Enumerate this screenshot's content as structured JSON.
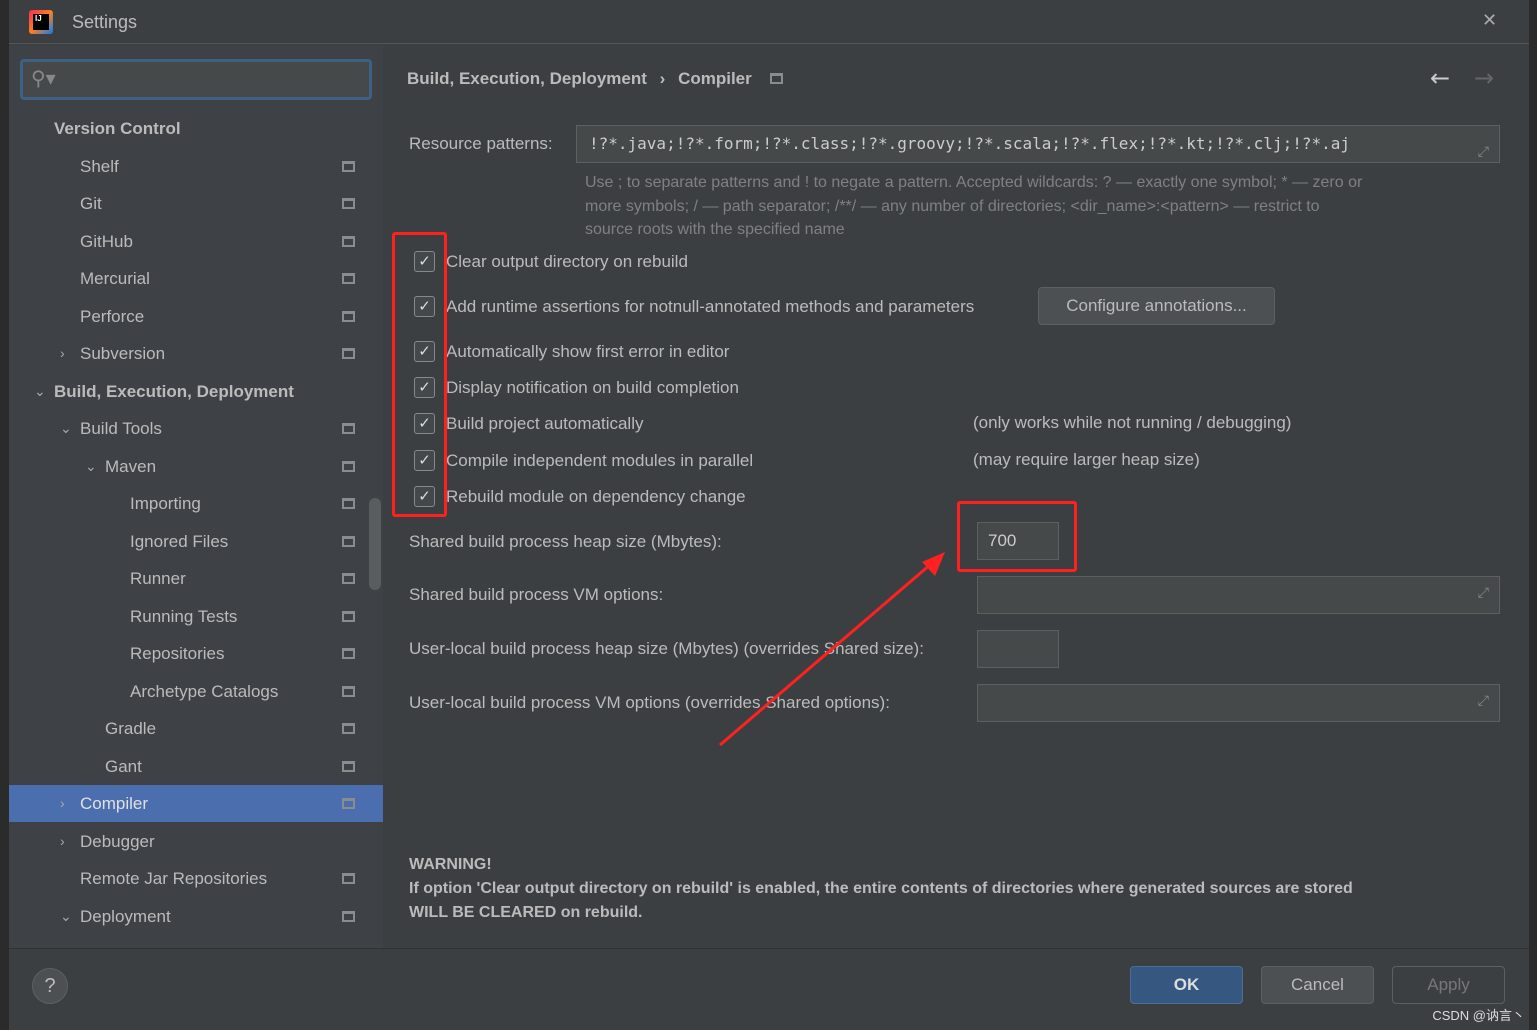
{
  "window": {
    "title": "Settings",
    "close": "✕"
  },
  "search": {
    "placeholder": ""
  },
  "tree": [
    {
      "label": "Version Control",
      "bold": true,
      "indent": 0,
      "chev": "",
      "proj": false
    },
    {
      "label": "Shelf",
      "indent": 1,
      "proj": true
    },
    {
      "label": "Git",
      "indent": 1,
      "proj": true
    },
    {
      "label": "GitHub",
      "indent": 1,
      "proj": true
    },
    {
      "label": "Mercurial",
      "indent": 1,
      "proj": true
    },
    {
      "label": "Perforce",
      "indent": 1,
      "proj": true
    },
    {
      "label": "Subversion",
      "indent": 1,
      "chev": "›",
      "proj": true
    },
    {
      "label": "Build, Execution, Deployment",
      "bold": true,
      "indent": 0,
      "chev": "⌄",
      "proj": false
    },
    {
      "label": "Build Tools",
      "indent": 1,
      "chev": "⌄",
      "proj": true
    },
    {
      "label": "Maven",
      "indent": 2,
      "chev": "⌄",
      "proj": true
    },
    {
      "label": "Importing",
      "indent": 3,
      "proj": true
    },
    {
      "label": "Ignored Files",
      "indent": 3,
      "proj": true
    },
    {
      "label": "Runner",
      "indent": 3,
      "proj": true
    },
    {
      "label": "Running Tests",
      "indent": 3,
      "proj": true
    },
    {
      "label": "Repositories",
      "indent": 3,
      "proj": true
    },
    {
      "label": "Archetype Catalogs",
      "indent": 3,
      "proj": true
    },
    {
      "label": "Gradle",
      "indent": 2,
      "proj": true
    },
    {
      "label": "Gant",
      "indent": 2,
      "proj": true
    },
    {
      "label": "Compiler",
      "indent": 1,
      "chev": "›",
      "proj": true,
      "selected": true
    },
    {
      "label": "Debugger",
      "indent": 1,
      "chev": "›",
      "proj": false
    },
    {
      "label": "Remote Jar Repositories",
      "indent": 1,
      "proj": true
    },
    {
      "label": "Deployment",
      "indent": 1,
      "chev": "⌄",
      "proj": true
    }
  ],
  "breadcrumb": {
    "parent": "Build, Execution, Deployment",
    "sep": "›",
    "current": "Compiler"
  },
  "nav": {
    "back": "←",
    "forward": "→"
  },
  "resource": {
    "label": "Resource patterns:",
    "value": "!?*.java;!?*.form;!?*.class;!?*.groovy;!?*.scala;!?*.flex;!?*.kt;!?*.clj;!?*.aj",
    "help_line1": "Use ; to separate patterns and ! to negate a pattern. Accepted wildcards: ? — exactly one symbol; * — zero or",
    "help_line2": "more symbols; / — path separator; /**/ — any number of directories; <dir_name>:<pattern> — restrict to",
    "help_line3": "source roots with the specified name"
  },
  "options": [
    {
      "label": "Clear output directory on rebuild",
      "checked": true,
      "note": ""
    },
    {
      "label": "Add runtime assertions for notnull-annotated methods and parameters",
      "checked": true,
      "note": ""
    },
    {
      "label": "Automatically show first error in editor",
      "checked": true,
      "note": ""
    },
    {
      "label": "Display notification on build completion",
      "checked": true,
      "note": ""
    },
    {
      "label": "Build project automatically",
      "checked": true,
      "note": "(only works while not running / debugging)"
    },
    {
      "label": "Compile independent modules in parallel",
      "checked": true,
      "note": "(may require larger heap size)"
    },
    {
      "label": "Rebuild module on dependency change",
      "checked": true,
      "note": ""
    }
  ],
  "configure_button": "Configure annotations...",
  "fields": {
    "heap_label": "Shared build process heap size (Mbytes):",
    "heap_value": "700",
    "vm_label": "Shared build process VM options:",
    "vm_value": "",
    "user_heap_label": "User-local build process heap size (Mbytes) (overrides Shared size):",
    "user_heap_value": "",
    "user_vm_label": "User-local build process VM options (overrides Shared options):",
    "user_vm_value": ""
  },
  "warning": {
    "title": "WARNING!",
    "line1": "If option 'Clear output directory on rebuild' is enabled, the entire contents of directories where generated sources are stored",
    "line2": "WILL BE CLEARED on rebuild."
  },
  "buttons": {
    "help": "?",
    "ok": "OK",
    "cancel": "Cancel",
    "apply": "Apply"
  },
  "watermark": "CSDN @讷言丶",
  "colors": {
    "accent": "#4b6eaf",
    "annotation": "#ff2020"
  }
}
